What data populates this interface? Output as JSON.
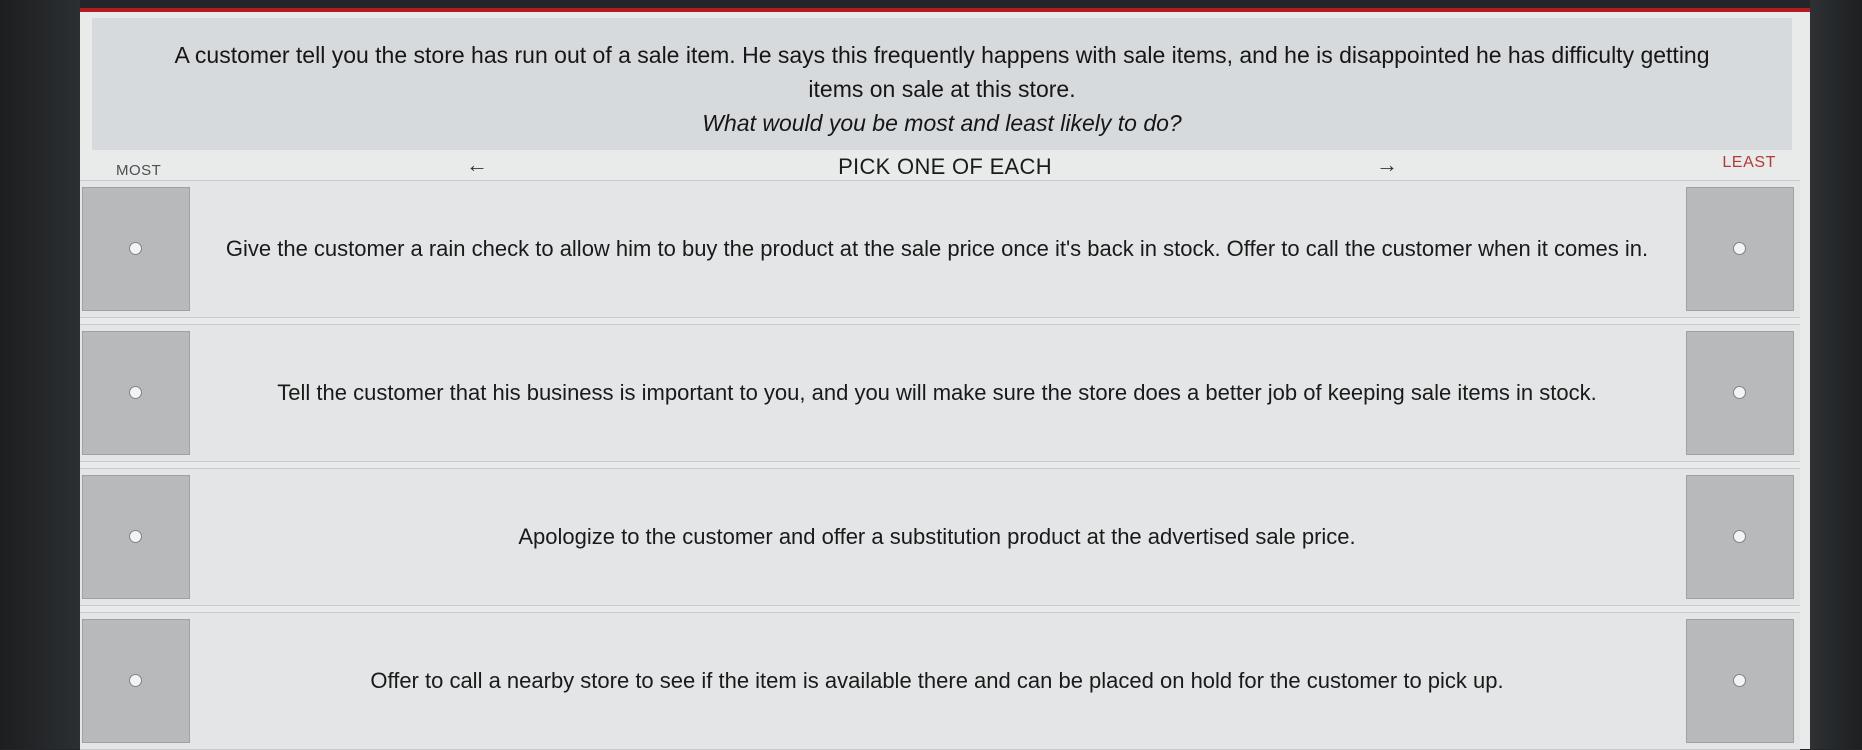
{
  "question": {
    "text": "A customer tell you the store has run out of a sale item. He says this frequently happens with sale items, and he is disappointed he has difficulty getting items on sale at this store.",
    "prompt": "What would you be most and least likely to do?"
  },
  "header": {
    "most_label": "MOST",
    "least_label": "LEAST",
    "pick_label": "PICK ONE OF EACH",
    "left_arrow": "←",
    "right_arrow": "→"
  },
  "options": [
    {
      "text": "Give the customer a rain check to allow him to buy the product at the sale price once it's back in stock. Offer to call the customer when it comes in."
    },
    {
      "text": "Tell the customer that his business is important to you, and you will make sure the store does a better job of keeping sale items in stock."
    },
    {
      "text": "Apologize to the customer and offer a substitution product at the advertised sale price."
    },
    {
      "text": "Offer to call a nearby store to see if the item is available there and can be placed on hold for the customer to pick up."
    }
  ],
  "colors": {
    "accent_red": "#b51c22",
    "least_label": "#b23a3a"
  }
}
